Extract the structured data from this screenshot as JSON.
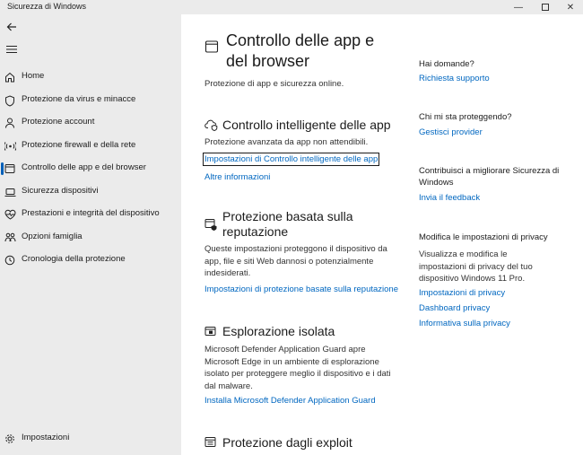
{
  "window": {
    "title": "Sicurezza di Windows"
  },
  "sidebar": {
    "items": [
      {
        "label": "Home",
        "icon": "home-icon"
      },
      {
        "label": "Protezione da virus e minacce",
        "icon": "shield-icon"
      },
      {
        "label": "Protezione account",
        "icon": "person-icon"
      },
      {
        "label": "Protezione firewall e della rete",
        "icon": "wifi-icon"
      },
      {
        "label": "Controllo delle app e del browser",
        "icon": "app-window-icon",
        "active": true
      },
      {
        "label": "Sicurezza dispositivi",
        "icon": "laptop-icon"
      },
      {
        "label": "Prestazioni e integrità del dispositivo",
        "icon": "heart-icon"
      },
      {
        "label": "Opzioni famiglia",
        "icon": "family-icon"
      },
      {
        "label": "Cronologia della protezione",
        "icon": "history-icon"
      }
    ],
    "settings_label": "Impostazioni"
  },
  "main": {
    "title": "Controllo delle app e del browser",
    "title_line1": "Controllo delle app e",
    "title_line2": "del browser",
    "subtitle": "Protezione di app e sicurezza online.",
    "sections": [
      {
        "title": "Controllo intelligente delle app",
        "desc": "Protezione avanzata da app non attendibili.",
        "links": [
          "Impostazioni di Controllo intelligente delle app",
          "Altre informazioni"
        ]
      },
      {
        "title_line1": "Protezione basata sulla",
        "title_line2": "reputazione",
        "desc": "Queste impostazioni proteggono il dispositivo da app, file e siti Web dannosi o potenzialmente indesiderati.",
        "links": [
          "Impostazioni di protezione basate sulla reputazione"
        ]
      },
      {
        "title": "Esplorazione isolata",
        "desc": "Microsoft Defender Application Guard apre Microsoft Edge in un ambiente di esplorazione isolato per proteggere meglio il dispositivo e i dati dal malware.",
        "links": [
          "Installa Microsoft Defender Application Guard"
        ]
      },
      {
        "title": "Protezione dagli exploit"
      }
    ]
  },
  "right": {
    "q1": {
      "heading": "Hai domande?",
      "link": "Richiesta supporto"
    },
    "q2": {
      "heading": "Chi mi sta proteggendo?",
      "link": "Gestisci provider"
    },
    "q3": {
      "heading": "Contribuisci a migliorare Sicurezza di Windows",
      "link": "Invia il feedback"
    },
    "q4": {
      "heading": "Modifica le impostazioni di privacy",
      "desc": "Visualizza e modifica le impostazioni di privacy del tuo dispositivo Windows 11 Pro.",
      "links": [
        "Impostazioni di privacy",
        "Dashboard privacy",
        "Informativa sulla privacy"
      ]
    }
  }
}
